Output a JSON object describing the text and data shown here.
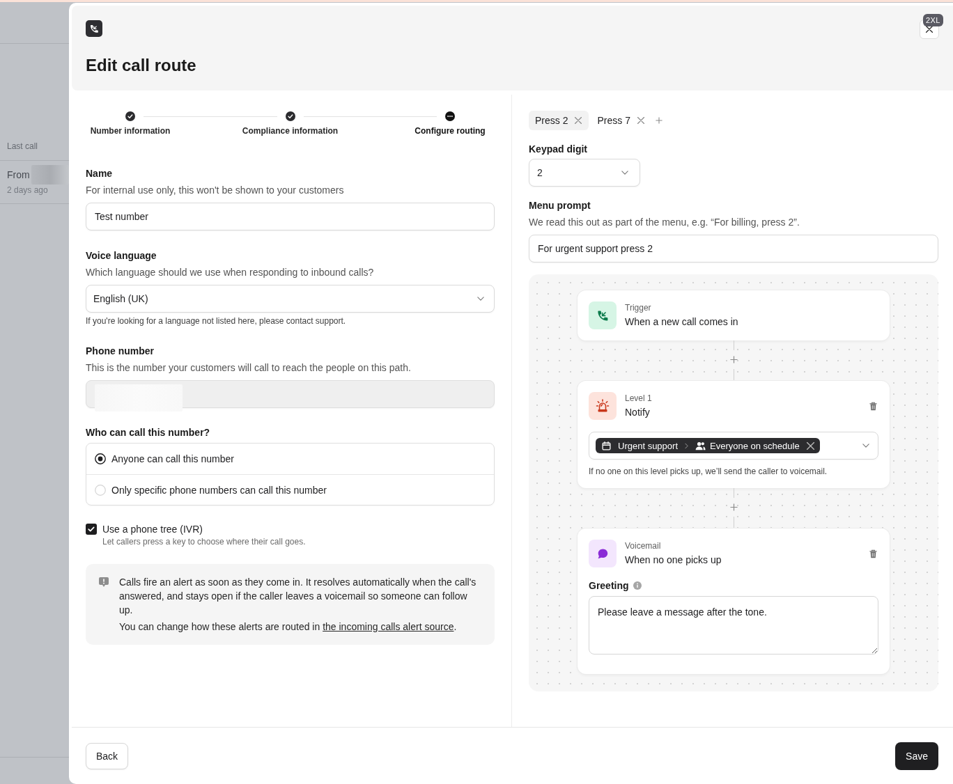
{
  "background_page": {
    "section_label": "Last call",
    "call": {
      "from_label": "From",
      "redacted": true,
      "time": "2 days ago"
    }
  },
  "modal": {
    "title": "Edit call route",
    "size_badge": "2XL"
  },
  "stepper": [
    {
      "label": "Number information",
      "completed": true,
      "current": false
    },
    {
      "label": "Compliance information",
      "completed": true,
      "current": false
    },
    {
      "label": "Configure routing",
      "completed": false,
      "current": true
    }
  ],
  "form": {
    "name": {
      "label": "Name",
      "description": "For internal use only, this won't be shown to your customers",
      "value": "Test number"
    },
    "voice_language": {
      "label": "Voice language",
      "description": "Which language should we use when responding to inbound calls?",
      "value": "English (UK)",
      "help": "If you're looking for a language not listed here, please contact support."
    },
    "phone_number": {
      "label": "Phone number",
      "description": "This is the number your customers will call to reach the people on this path.",
      "disabled": true,
      "redacted": true
    },
    "who_can_call": {
      "label": "Who can call this number?",
      "options": [
        {
          "label": "Anyone can call this number",
          "selected": true
        },
        {
          "label": "Only specific phone numbers can call this number",
          "selected": false
        }
      ]
    },
    "phone_tree": {
      "label": "Use a phone tree (IVR)",
      "description": "Let callers press a key to choose where their call goes.",
      "checked": true
    },
    "callout": {
      "text": "Calls fire an alert as soon as they come in. It resolves automatically when the call's answered, and stays open if the caller leaves a voicemail so someone can follow up.",
      "link_intro": "You can change how these alerts are routed in",
      "link": "the incoming calls alert source",
      "link_outro": "."
    }
  },
  "routing": {
    "tabs": [
      {
        "label": "Press 2",
        "selected": true
      },
      {
        "label": "Press 7",
        "selected": false
      }
    ],
    "keypad_digit": {
      "label": "Keypad digit",
      "value": "2"
    },
    "menu_prompt": {
      "label": "Menu prompt",
      "description": "We read this out as part of the menu, e.g. “For billing, press 2”.",
      "value": "For urgent support press 2"
    },
    "flow": [
      {
        "kind": "trigger",
        "type_label": "Trigger",
        "title": "When a new call comes in"
      },
      {
        "kind": "notify",
        "type_label": "Level 1",
        "title": "Notify",
        "target": {
          "schedule": "Urgent support",
          "audience": "Everyone on schedule"
        },
        "note": "If no one on this level picks up, we’ll send the caller to voicemail."
      },
      {
        "kind": "voicemail",
        "type_label": "Voicemail",
        "title": "When no one picks up",
        "field_label": "Greeting",
        "value": "Please leave a message after the tone."
      }
    ]
  },
  "footer": {
    "back": "Back",
    "save": "Save"
  }
}
